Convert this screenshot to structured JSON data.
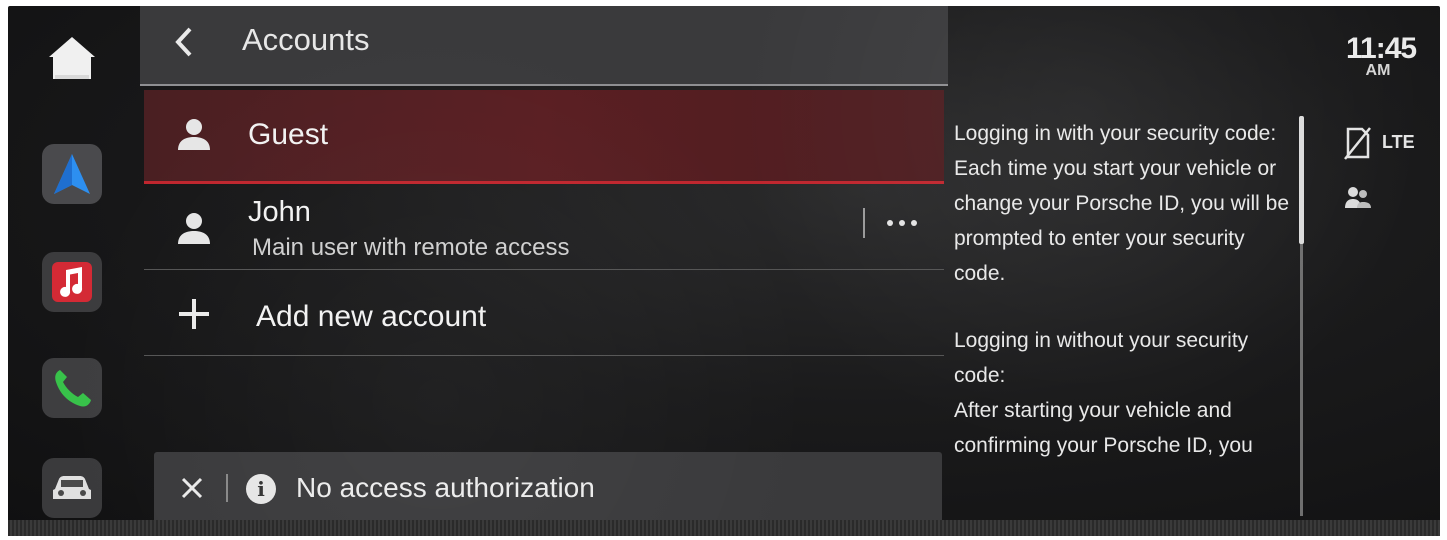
{
  "header": {
    "title": "Accounts"
  },
  "accounts": [
    {
      "name": "Guest",
      "subtitle": "",
      "selected": true
    },
    {
      "name": "John",
      "subtitle": "Main user with remote access",
      "selected": false
    }
  ],
  "add_account": {
    "label": "Add new account"
  },
  "notice": {
    "text": "No access authorization"
  },
  "info_text": {
    "para1": "Logging in with your security code:\nEach time you start your vehicle or change your Porsche ID, you will be prompted to enter your security code.",
    "para2": "Logging in without your security code:\nAfter starting your vehicle and confirming your Porsche ID, you"
  },
  "status": {
    "time": "11:45",
    "ampm": "AM",
    "network": "LTE"
  },
  "colors": {
    "accent": "#c0262e",
    "selected_row": "#561e22",
    "panel": "#3a3a3c"
  },
  "icons": {
    "dock": [
      "home-icon",
      "navigation-icon",
      "music-icon",
      "phone-icon",
      "car-icon"
    ],
    "rows": [
      "person-icon",
      "person-icon",
      "plus-icon"
    ]
  }
}
